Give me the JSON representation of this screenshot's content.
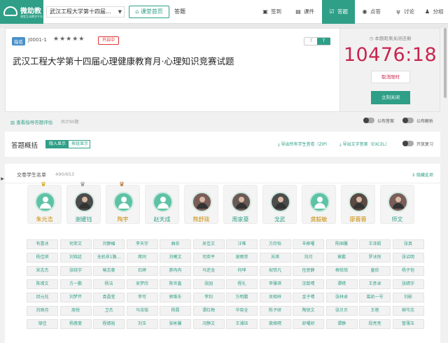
{
  "app": {
    "name": "微助教",
    "tagline": "课堂互动教学平台"
  },
  "course_selector": {
    "value": "武汉工程大学第十四届..."
  },
  "home_button": {
    "label": "课堂首页"
  },
  "breadcrumb": {
    "current": "答题"
  },
  "nav": [
    {
      "label": "签到",
      "icon": "checkin-icon",
      "active": false
    },
    {
      "label": "课件",
      "icon": "slides-icon",
      "active": false
    },
    {
      "label": "答题",
      "icon": "quiz-icon",
      "active": true
    },
    {
      "label": "点答",
      "icon": "point-icon",
      "active": false
    },
    {
      "label": "讨论",
      "icon": "discussion-icon",
      "active": false
    },
    {
      "label": "分组",
      "icon": "group-icon",
      "active": false
    }
  ],
  "exam": {
    "origin_tag": "指名",
    "id": "J0001-1",
    "stars": "★★★★★",
    "rating": 5,
    "status": "开启中",
    "toggle_left": "T",
    "toggle_right": "T",
    "title": "武汉工程大学第十四届心理健康教育月·心理知识竞赛试题"
  },
  "timer": {
    "label": "本题距离关闭还剩",
    "value": "10476:18",
    "cancel_label": "取消限时",
    "close_label": "立刻关闭"
  },
  "options": {
    "view_report": "查看指导答题评估",
    "total_questions": "共计90题",
    "public_answer": "公布答案",
    "public_analysis": "公布解析"
  },
  "overview": {
    "title": "答题概括",
    "seg_on": "隐入显示",
    "seg_off": "按组显示",
    "export_all": "导出所有学生答卷（ZIP）",
    "export_text": "导出文字答案（EXCEL）",
    "review": "开放复习"
  },
  "submitters": {
    "label": "交卷学生名单",
    "count": "490/653",
    "hide_list": "隐藏此项",
    "top": [
      {
        "name": "朱元浩",
        "crown": "gold",
        "photo": false
      },
      {
        "name": "谢媛钰",
        "crown": "silver",
        "photo": true
      },
      {
        "name": "陶宇",
        "crown": "bronze",
        "photo": false
      },
      {
        "name": "赵天成",
        "crown": "",
        "photo": false
      },
      {
        "name": "熊舒琰",
        "crown": "",
        "photo": true
      },
      {
        "name": "周家豪",
        "crown": "",
        "photo": true
      },
      {
        "name": "戈武",
        "crown": "",
        "photo": true
      },
      {
        "name": "龚毅敏",
        "crown": "",
        "photo": false
      },
      {
        "name": "廖蓉蓉",
        "crown": "",
        "photo": true
      },
      {
        "name": "师文",
        "crown": "",
        "photo": true
      }
    ],
    "rows": [
      [
        "有喜冰",
        "何菲文",
        "刘静楣",
        "李天宇",
        "曲奈",
        "吴佳文",
        "汪唯",
        "方欣怡",
        "羊柳曜",
        "陈国馨",
        "王泽毅",
        "张真"
      ],
      [
        "杨佳琪",
        "刘铭廷",
        "无机非1路...",
        "蒋同",
        "刘曦文",
        "司奕平",
        "谢雨菲",
        "苏琪",
        "刘闪",
        "章鹏",
        "罗冰悦",
        "张诏明"
      ],
      [
        "宋志杰",
        "张晓宇",
        "喻志豪",
        "石婷",
        "廖冉冉",
        "马逆龙",
        "何坤",
        "祝铁凡",
        "任思静",
        "梅恬恬",
        "童欣",
        "杨子恺"
      ],
      [
        "陈靖文",
        "方一鹏",
        "杨洁",
        "吴梦欣",
        "陈世鑫",
        "张园",
        "程礼",
        "李雅琪",
        "沈歆晴",
        "谭晴",
        "王彦卓",
        "张婧宇"
      ],
      [
        "邱元兆",
        "刘梦芹",
        "袁晶莹",
        "李可",
        "郭维东",
        "李钊",
        "万明鹏",
        "贡相祥",
        "金子晴",
        "张林卓",
        "葛凯一号",
        "刘影"
      ],
      [
        "刘映月",
        "周悦",
        "卫杰",
        "马浩铭",
        "杨霞",
        "谭红梅",
        "华晓全",
        "陈子研",
        "陶锐文",
        "张贝贝",
        "王艳",
        "柳岑志"
      ],
      [
        "邹佳",
        "杨惠斐",
        "程婧裕",
        "刘玉",
        "张彬馨",
        "况静文",
        "王湘钰",
        "裴焕晴",
        "舒曜研",
        "谭静",
        "段亮亮",
        "管薄玉"
      ]
    ]
  },
  "colors": {
    "accent": "#2f9f87",
    "timer": "#c7254e",
    "status": "#dd3333"
  }
}
